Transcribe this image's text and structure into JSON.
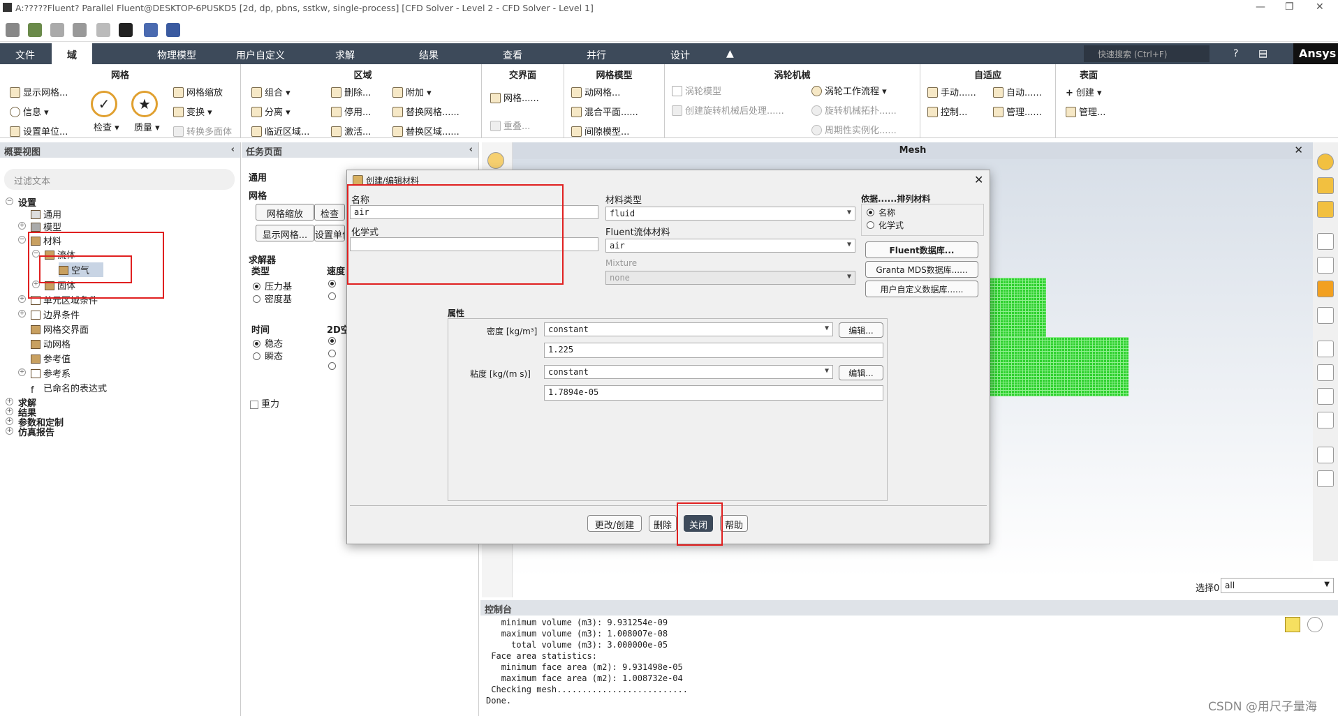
{
  "window": {
    "title": "A:?????Fluent? Parallel Fluent@DESKTOP-6PUSKD5  [2d, dp, pbns, sstkw, single-process] [CFD Solver - Level 2 - CFD Solver - Level 1]"
  },
  "menubar": {
    "items": [
      "文件",
      "域",
      "物理模型",
      "用户自定义",
      "求解",
      "结果",
      "查看",
      "并行",
      "设计"
    ],
    "search_placeholder": "快速搜索 (Ctrl+F)",
    "brand": "Ansys"
  },
  "ribbon": {
    "mesh": {
      "title": "网格",
      "display": "显示网格...",
      "info": "信息",
      "units": "设置单位...",
      "check": "检查",
      "quality": "质量",
      "scale": "网格缩放",
      "transform": "变换",
      "convert": "转换多面体"
    },
    "zones": {
      "title": "区域",
      "combine": "组合",
      "separate": "分离",
      "adjacency": "临近区域...",
      "delete": "删除...",
      "deactivate": "停用...",
      "activate": "激活...",
      "append": "附加",
      "replace_mesh": "替换网格......",
      "replace_zone": "替换区域......"
    },
    "interface": {
      "title": "交界面",
      "mesh": "网格......",
      "overlap": "重叠..."
    },
    "mesh_models": {
      "title": "网格模型",
      "dynamic": "动网格...",
      "mixing": "混合平面......",
      "gap": "间隙模型..."
    },
    "turbo": {
      "title": "涡轮机械",
      "model": "涡轮模型",
      "post": "创建旋转机械后处理......",
      "workflow": "涡轮工作流程",
      "topology": "旋转机械拓扑......",
      "periodic": "周期性实例化......"
    },
    "adapt": {
      "title": "自适应",
      "manual": "手动......",
      "auto": "自动......",
      "control": "控制...",
      "manage": "管理......"
    },
    "surface": {
      "title": "表面",
      "create": "创建",
      "manage": "管理..."
    }
  },
  "outline": {
    "title": "概要视图",
    "filter_placeholder": "过滤文本",
    "tree": [
      "设置",
      "通用",
      "模型",
      "材料",
      "流体",
      "空气",
      "固体",
      "单元区域条件",
      "边界条件",
      "网格交界面",
      "动网格",
      "参考值",
      "参考系",
      "已命名的表达式",
      "求解",
      "结果",
      "参数和定制",
      "仿真报告"
    ]
  },
  "task": {
    "title": "任务页面",
    "general": "通用",
    "mesh": "网格",
    "scale_btn": "网格缩放",
    "check_btn": "检查",
    "display_btn": "显示网格...",
    "units_btn": "设置单位",
    "solver": "求解器",
    "type": "类型",
    "velocity": "速度",
    "pressure_based": "压力基",
    "density_based": "密度基",
    "time": "时间",
    "space2d": "2D空",
    "steady": "稳态",
    "transient": "瞬态",
    "gravity": "重力"
  },
  "graphics": {
    "title": "Mesh",
    "select_label": "选择0",
    "select_value": "all"
  },
  "console": {
    "title": "控制台",
    "lines": [
      "   minimum volume (m3): 9.931254e-09",
      "   maximum volume (m3): 1.008007e-08",
      "     total volume (m3): 3.000000e-05",
      " Face area statistics:",
      "   minimum face area (m2): 9.931498e-05",
      "   maximum face area (m2): 1.008732e-04",
      " Checking mesh..........................",
      "Done."
    ]
  },
  "dialog": {
    "title": "创建/编辑材料",
    "name_label": "名称",
    "name_value": "air",
    "formula_label": "化学式",
    "formula_value": "",
    "mat_type_label": "材料类型",
    "mat_type_value": "fluid",
    "fluent_mat_label": "Fluent流体材料",
    "fluent_mat_value": "air",
    "mixture_label": "Mixture",
    "mixture_value": "none",
    "order_label": "依据......排列材料",
    "order_name": "名称",
    "order_formula": "化学式",
    "db_fluent": "Fluent数据库...",
    "db_granta": "Granta MDS数据库......",
    "db_user": "用户自定义数据库......",
    "props_label": "属性",
    "density_label": "密度 [kg/m³]",
    "density_method": "constant",
    "density_value": "1.225",
    "edit1": "编辑...",
    "viscosity_label": "粘度 [kg/(m s)]",
    "viscosity_method": "constant",
    "viscosity_value": "1.7894e-05",
    "edit2": "编辑...",
    "btn_change": "更改/创建",
    "btn_delete": "删除",
    "btn_close": "关闭",
    "btn_help": "帮助"
  },
  "watermark": "CSDN @用尺子量海"
}
